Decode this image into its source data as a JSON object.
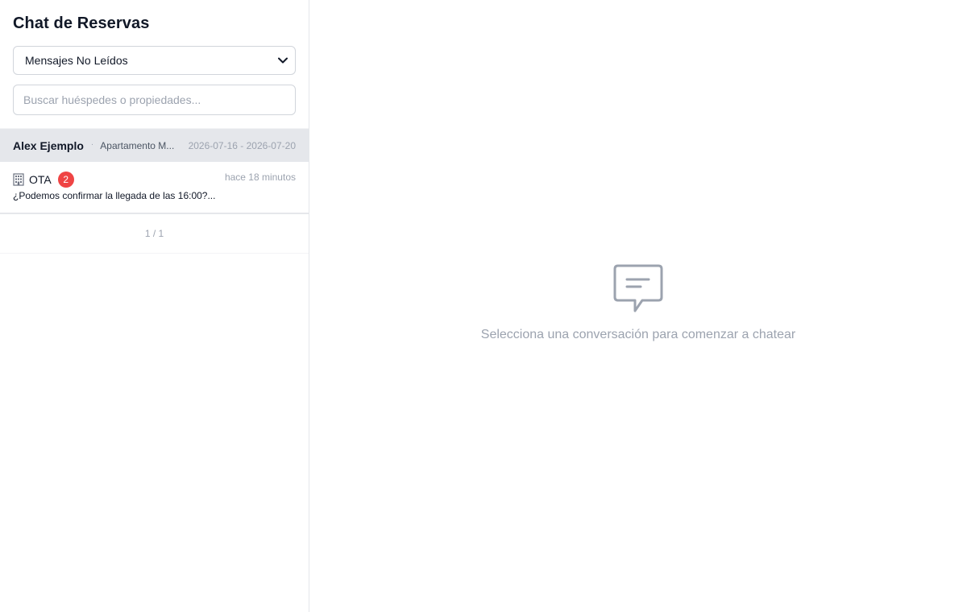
{
  "sidebar": {
    "title": "Chat de Reservas",
    "filter": {
      "selected": "Mensajes No Leídos"
    },
    "search": {
      "placeholder": "Buscar huéspedes o propiedades...",
      "value": ""
    },
    "groups": [
      {
        "guest": "Alex Ejemplo",
        "separator": "·",
        "property": "Apartamento M...",
        "dates": "2026-07-16 - 2026-07-20",
        "conversation": {
          "channel_icon": "building-icon",
          "channel": "OTA",
          "unread": "2",
          "time": "hace 18 minutos",
          "preview": "¿Podemos confirmar la llegada de las 16:00?..."
        }
      }
    ],
    "pagination": "1 / 1"
  },
  "main": {
    "empty_icon": "chat-bubble-icon",
    "empty_text": "Selecciona una conversación para comenzar a chatear"
  },
  "colors": {
    "badge": "#ef4444",
    "group_header_bg": "#e5e7eb",
    "muted_text": "#9ca3af"
  }
}
